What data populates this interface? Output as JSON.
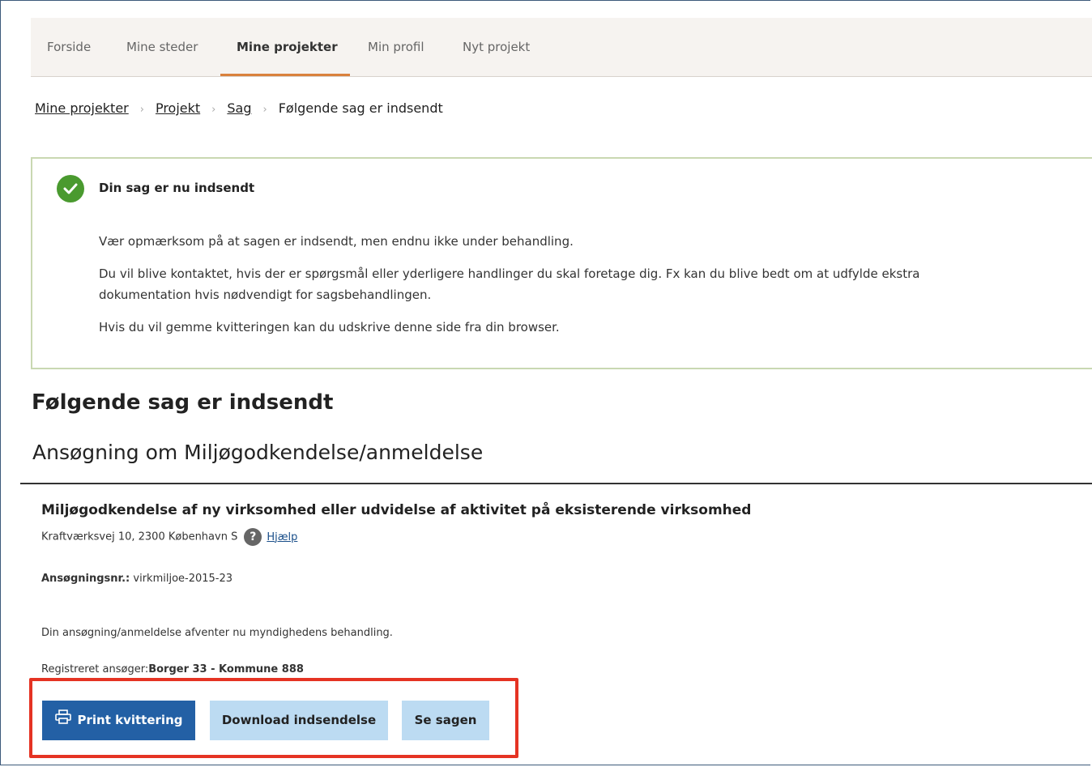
{
  "nav": {
    "tabs": [
      "Forside",
      "Mine steder",
      "Mine projekter",
      "Min profil",
      "Nyt projekt"
    ],
    "active_tab": "Mine projekter"
  },
  "breadcrumb": {
    "items": [
      "Mine projekter",
      "Projekt",
      "Sag"
    ],
    "current": "Følgende sag er indsendt"
  },
  "notice": {
    "title": "Din sag er nu indsendt",
    "paragraphs": [
      "Vær opmærksom på at sagen er indsendt, men endnu ikke under behandling.",
      "Du vil blive kontaktet, hvis der er spørgsmål eller yderligere handlinger du skal foretage dig. Fx kan du blive bedt om at udfylde ekstra dokumentation hvis nødvendigt for sagsbehandlingen.",
      "Hvis du vil gemme kvitteringen kan du udskrive denne side fra din browser."
    ]
  },
  "main": {
    "heading": "Følgende sag er indsendt",
    "subheading": "Ansøgning om Miljøgodkendelse/anmeldelse"
  },
  "case": {
    "title": "Miljøgodkendelse af ny virksomhed eller udvidelse af aktivitet på eksisterende virksomhed",
    "address": "Kraftværksvej 10, 2300 København S",
    "help_label": "Hjælp",
    "help_icon": "?",
    "application_no_label": "Ansøgningsnr.:",
    "application_no": "virkmiljoe-2015-23",
    "status_text": "Din ansøgning/anmeldelse afventer nu myndighedens behandling.",
    "applicant_label": "Registreret ansøger:",
    "applicant": "Borger 33 - Kommune 888"
  },
  "buttons": {
    "print": "Print kvittering",
    "download": "Download indsendelse",
    "view": "Se sagen"
  },
  "colors": {
    "accent_orange": "#d9813d",
    "success_green": "#4a9a2f",
    "primary_blue": "#2360a5",
    "secondary_blue": "#bcdbf2",
    "highlight_red": "#e53323"
  }
}
